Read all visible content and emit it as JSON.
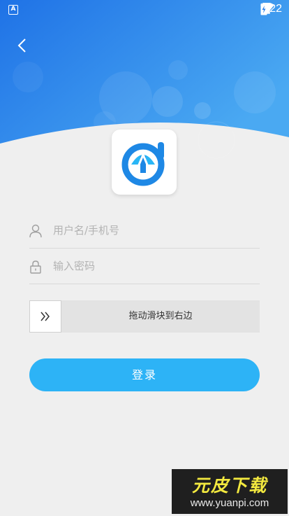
{
  "status_bar": {
    "time": "7:22",
    "app_icon_letter": "A",
    "icons": [
      "wifi-icon",
      "no-signal-icon",
      "battery-charging-icon"
    ]
  },
  "header": {
    "back_icon": "back-arrow-icon",
    "gradient_colors": [
      "#1f72e6",
      "#4aa9f2"
    ]
  },
  "logo": {
    "icon": "app-logo-icon",
    "colors": [
      "#1e88e5",
      "#29b6f6"
    ]
  },
  "form": {
    "username": {
      "placeholder": "用户名/手机号",
      "value": "",
      "icon": "user-icon"
    },
    "password": {
      "placeholder": "输入密码",
      "value": "",
      "icon": "lock-icon"
    },
    "slider": {
      "label": "拖动滑块到右边",
      "handle_icon": "double-chevron-right-icon",
      "progress": 0
    },
    "login_label": "登录",
    "accent_color": "#2db3f6"
  },
  "watermark": {
    "title": "元皮下载",
    "url": "www.yuanpi.com"
  }
}
